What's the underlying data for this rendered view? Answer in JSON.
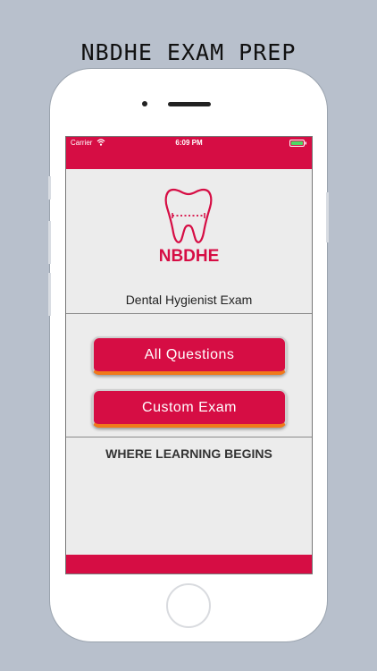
{
  "promo": {
    "title": "NBDHE EXAM PREP"
  },
  "status_bar": {
    "carrier": "Carrier",
    "time": "6:09 PM"
  },
  "logo": {
    "app_name": "NBDHE",
    "subtitle": "Dental Hygienist Exam"
  },
  "buttons": {
    "all_questions": "All Questions",
    "custom_exam": "Custom Exam"
  },
  "tagline": "WHERE LEARNING BEGINS",
  "colors": {
    "brand": "#d60d44",
    "accent_border": "#f07a1b",
    "screen_bg": "#ececec",
    "page_bg": "#b8c0cc"
  },
  "icons": [
    "wifi-icon",
    "battery-icon",
    "tooth-icon",
    "home-button"
  ]
}
